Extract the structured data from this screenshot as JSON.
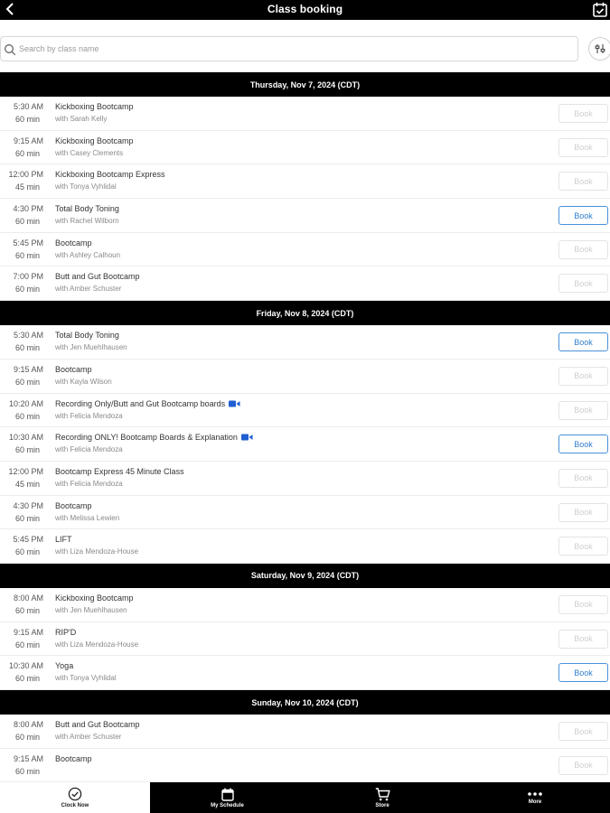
{
  "header": {
    "title": "Class booking"
  },
  "search": {
    "placeholder": "Search by class name",
    "value": ""
  },
  "colors": {
    "bar": "#000000",
    "book_enabled": "#2f7fcf",
    "book_disabled": "#cfcfcf"
  },
  "days": [
    {
      "header": "Thursday, Nov 7, 2024 (CDT)",
      "classes": [
        {
          "time": "5:30 AM",
          "duration": "60 min",
          "name": "Kickboxing Bootcamp",
          "instructor": "with Sarah Kelly",
          "book": "Book",
          "enabled": false,
          "video": false
        },
        {
          "time": "9:15 AM",
          "duration": "60 min",
          "name": "Kickboxing Bootcamp",
          "instructor": "with Casey Clements",
          "book": "Book",
          "enabled": false,
          "video": false
        },
        {
          "time": "12:00 PM",
          "duration": "45 min",
          "name": "Kickboxing Bootcamp Express",
          "instructor": "with Tonya Vyhlidal",
          "book": "Book",
          "enabled": false,
          "video": false
        },
        {
          "time": "4:30 PM",
          "duration": "60 min",
          "name": "Total Body Toning",
          "instructor": "with Rachel Wilborn",
          "book": "Book",
          "enabled": true,
          "video": false
        },
        {
          "time": "5:45 PM",
          "duration": "60 min",
          "name": "Bootcamp",
          "instructor": "with Ashley Calhoun",
          "book": "Book",
          "enabled": false,
          "video": false
        },
        {
          "time": "7:00 PM",
          "duration": "60 min",
          "name": "Butt and Gut Bootcamp",
          "instructor": "with Amber Schuster",
          "book": "Book",
          "enabled": false,
          "video": false
        }
      ]
    },
    {
      "header": "Friday, Nov 8, 2024 (CDT)",
      "classes": [
        {
          "time": "5:30 AM",
          "duration": "60 min",
          "name": "Total Body Toning",
          "instructor": "with Jen Muehlhausen",
          "book": "Book",
          "enabled": true,
          "video": false
        },
        {
          "time": "9:15 AM",
          "duration": "60 min",
          "name": "Bootcamp",
          "instructor": "with Kayla Wilson",
          "book": "Book",
          "enabled": false,
          "video": false
        },
        {
          "time": "10:20 AM",
          "duration": "60 min",
          "name": "Recording Only/Butt and Gut Bootcamp boards",
          "instructor": "with Felicia Mendoza",
          "book": "Book",
          "enabled": false,
          "video": true
        },
        {
          "time": "10:30 AM",
          "duration": "60 min",
          "name": "Recording ONLY! Bootcamp Boards & Explanation",
          "instructor": "with Felicia Mendoza",
          "book": "Book",
          "enabled": true,
          "video": true
        },
        {
          "time": "12:00 PM",
          "duration": "45 min",
          "name": "Bootcamp Express 45 Minute Class",
          "instructor": "with Felicia Mendoza",
          "book": "Book",
          "enabled": false,
          "video": false
        },
        {
          "time": "4:30 PM",
          "duration": "60 min",
          "name": "Bootcamp",
          "instructor": "with Melissa Lewien",
          "book": "Book",
          "enabled": false,
          "video": false
        },
        {
          "time": "5:45 PM",
          "duration": "60 min",
          "name": "LIFT",
          "instructor": "with Liza Mendoza-House",
          "book": "Book",
          "enabled": false,
          "video": false
        }
      ]
    },
    {
      "header": "Saturday, Nov 9, 2024 (CDT)",
      "classes": [
        {
          "time": "8:00 AM",
          "duration": "60 min",
          "name": "Kickboxing Bootcamp",
          "instructor": "with Jen Muehlhausen",
          "book": "Book",
          "enabled": false,
          "video": false
        },
        {
          "time": "9:15 AM",
          "duration": "60 min",
          "name": "RIP'D",
          "instructor": "with Liza Mendoza-House",
          "book": "Book",
          "enabled": false,
          "video": false
        },
        {
          "time": "10:30 AM",
          "duration": "60 min",
          "name": "Yoga",
          "instructor": "with Tonya Vyhlidal",
          "book": "Book",
          "enabled": true,
          "video": false
        }
      ]
    },
    {
      "header": "Sunday, Nov 10, 2024 (CDT)",
      "classes": [
        {
          "time": "8:00 AM",
          "duration": "60 min",
          "name": "Butt and Gut Bootcamp",
          "instructor": "with Amber Schuster",
          "book": "Book",
          "enabled": false,
          "video": false
        },
        {
          "time": "9:15 AM",
          "duration": "60 min",
          "name": "Bootcamp",
          "instructor": "",
          "book": "Book",
          "enabled": false,
          "video": false
        }
      ]
    }
  ],
  "bottom_nav": [
    {
      "label": "Clock Now",
      "icon": "check-circle-icon",
      "theme": "light"
    },
    {
      "label": "My Schedule",
      "icon": "calendar-icon",
      "theme": "dark"
    },
    {
      "label": "Store",
      "icon": "cart-icon",
      "theme": "dark"
    },
    {
      "label": "More",
      "icon": "dots-icon",
      "theme": "dark"
    }
  ]
}
